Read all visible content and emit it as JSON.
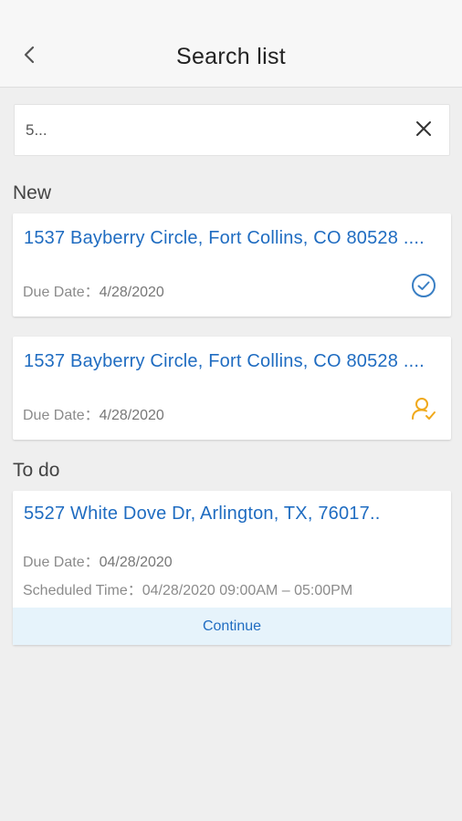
{
  "header": {
    "title": "Search list",
    "back_icon": "chevron-left-icon"
  },
  "search": {
    "value": "5...",
    "clear_icon": "close-icon"
  },
  "sections": {
    "new_label": "New",
    "todo_label": "To do"
  },
  "new_items": [
    {
      "address": "1537 Bayberry Circle, Fort Collins, CO 80528 ....",
      "due_label": "Due Date：",
      "due_value": "4/28/2020",
      "status_icon": "check-circle-icon",
      "status_color": "#3a7fc4"
    },
    {
      "address": "1537 Bayberry Circle, Fort Collins, CO 80528 ....",
      "due_label": "Due Date：",
      "due_value": "4/28/2020",
      "status_icon": "user-check-icon",
      "status_color": "#f0a91b"
    }
  ],
  "todo_items": [
    {
      "address": "5527 White Dove Dr, Arlington, TX, 76017..",
      "due_label": "Due Date：",
      "due_value": "04/28/2020",
      "scheduled_label": "Scheduled Time：",
      "scheduled_value": "04/28/2020 09:00AM – 05:00PM",
      "action_label": "Continue"
    }
  ],
  "colors": {
    "accent": "#1f6cc1",
    "background": "#efefef",
    "continue_bg": "#e6f3fb"
  }
}
